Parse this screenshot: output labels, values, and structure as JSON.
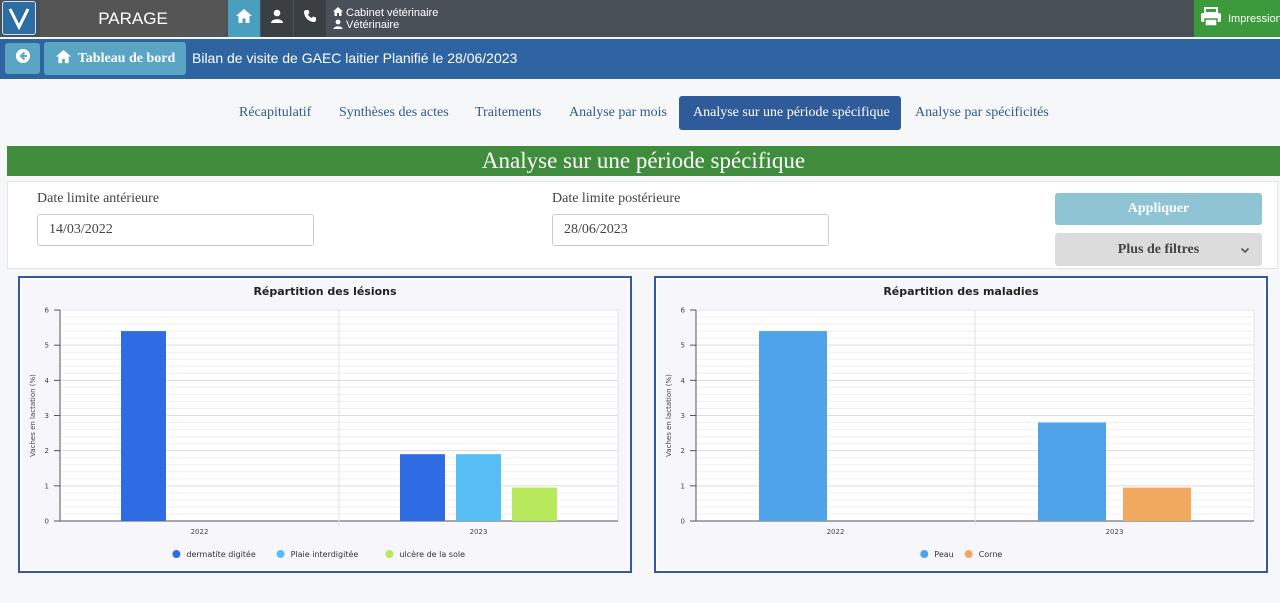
{
  "topbar": {
    "app_name": "PARAGE",
    "cabinet": "Cabinet vétérinaire",
    "role": "Vétérinaire",
    "print_label": "Impression",
    "icons": [
      "logo-v",
      "home-icon",
      "user-icon",
      "phone-icon"
    ]
  },
  "subbar": {
    "dashboard_label": "Tableau de bord",
    "breadcrumb": "Bilan de visite de GAEC laitier  Planifié le 28/06/2023"
  },
  "tabs": [
    {
      "label": "Récapitulatif",
      "active": false
    },
    {
      "label": "Synthèses des actes",
      "active": false
    },
    {
      "label": "Traitements",
      "active": false
    },
    {
      "label": "Analyse par mois",
      "active": false
    },
    {
      "label": "Analyse sur une période spécifique",
      "active": true
    },
    {
      "label": "Analyse par spécificités",
      "active": false
    }
  ],
  "section_title": "Analyse sur une période spécifique",
  "filters": {
    "date_start_label": "Date limite antérieure",
    "date_start_value": "14/03/2022",
    "date_end_label": "Date limite postérieure",
    "date_end_value": "28/06/2023",
    "apply_label": "Appliquer",
    "more_label": "Plus de filtres"
  },
  "colors": {
    "topbar": "#495057",
    "subbar": "#2f64a3",
    "banner": "#3f8c3c",
    "print": "#3d9a3c"
  },
  "chart_data": [
    {
      "type": "bar",
      "title": "Répartition des lésions",
      "xlabel": "",
      "ylabel": "Vaches en lactation (%)",
      "ylim": [
        0,
        6
      ],
      "yticks": [
        "0",
        "1",
        "2",
        "3",
        "4",
        "5",
        "6"
      ],
      "categories": [
        "2022",
        "2023"
      ],
      "grid": true,
      "legend_position": "bottom",
      "series": [
        {
          "name": "dermatite digitée",
          "color": "#2f6be3",
          "values": [
            5.4,
            1.9
          ]
        },
        {
          "name": "Plaie interdigitée",
          "color": "#56bdf5",
          "values": [
            0,
            1.9
          ]
        },
        {
          "name": "ulcère de la sole",
          "color": "#b8e85c",
          "values": [
            0,
            0.95
          ]
        }
      ]
    },
    {
      "type": "bar",
      "title": "Répartition des maladies",
      "xlabel": "",
      "ylabel": "Vaches en lactation (%)",
      "ylim": [
        0,
        6
      ],
      "yticks": [
        "0",
        "1",
        "2",
        "3",
        "4",
        "5",
        "6"
      ],
      "categories": [
        "2022",
        "2023"
      ],
      "grid": true,
      "legend_position": "bottom",
      "series": [
        {
          "name": "Peau",
          "color": "#4fa3e8",
          "values": [
            5.4,
            2.8
          ]
        },
        {
          "name": "Corne",
          "color": "#f0a95e",
          "values": [
            0,
            0.95
          ]
        }
      ]
    }
  ]
}
